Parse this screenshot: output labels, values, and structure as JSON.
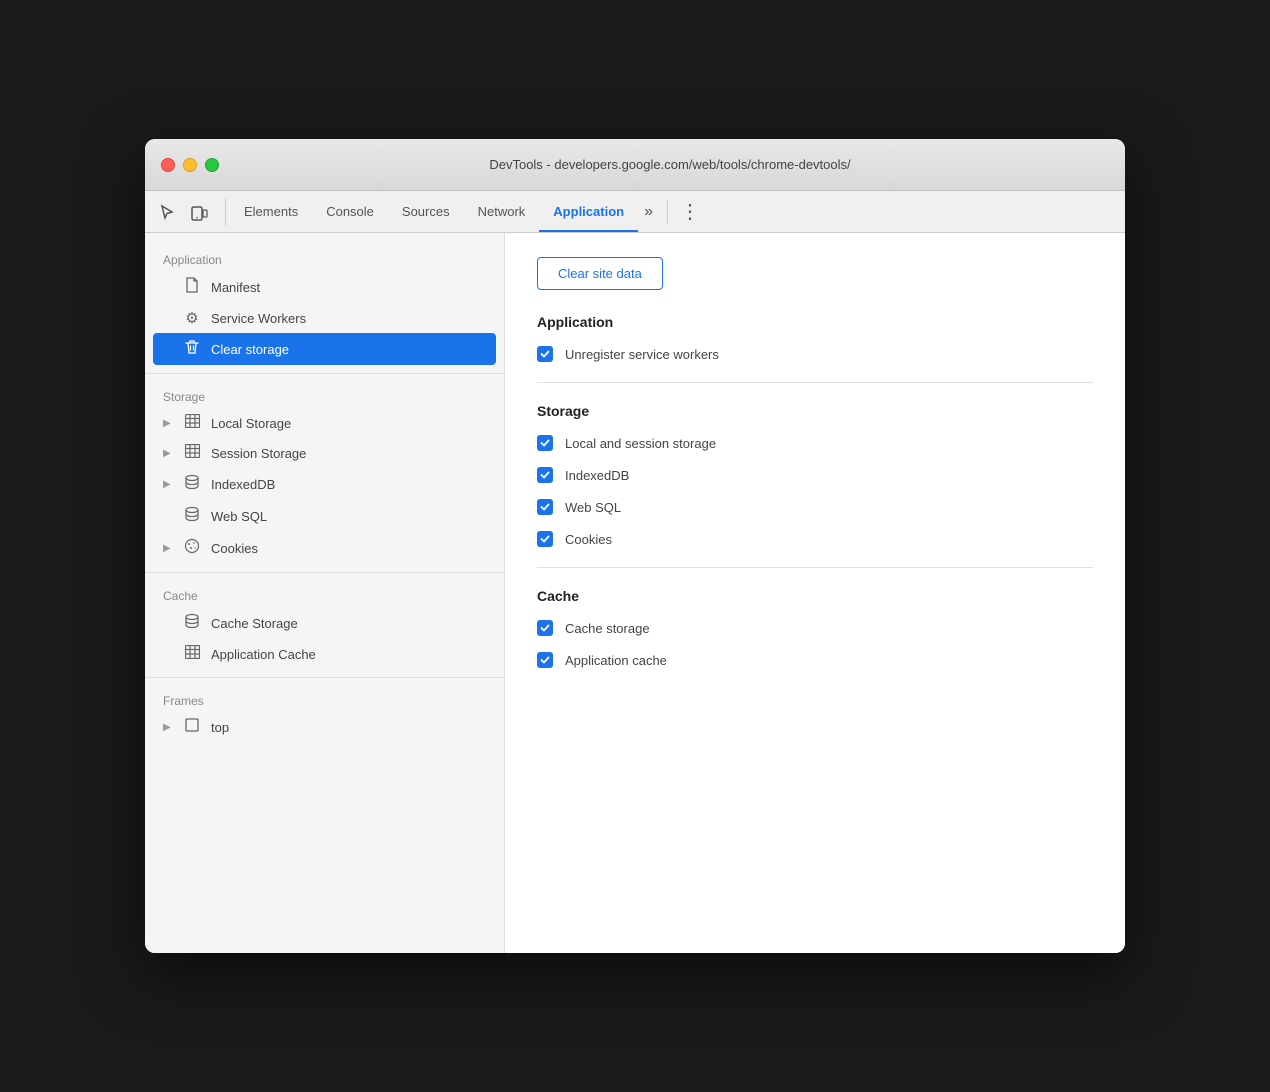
{
  "window": {
    "title": "DevTools - developers.google.com/web/tools/chrome-devtools/",
    "traffic_lights": {
      "close": "close",
      "minimize": "minimize",
      "maximize": "maximize"
    }
  },
  "toolbar": {
    "icons": [
      {
        "name": "cursor-icon",
        "symbol": "⬚"
      },
      {
        "name": "device-icon",
        "symbol": "⧉"
      }
    ],
    "tabs": [
      {
        "id": "elements",
        "label": "Elements",
        "active": false
      },
      {
        "id": "console",
        "label": "Console",
        "active": false
      },
      {
        "id": "sources",
        "label": "Sources",
        "active": false
      },
      {
        "id": "network",
        "label": "Network",
        "active": false
      },
      {
        "id": "application",
        "label": "Application",
        "active": true
      }
    ],
    "more_label": "»",
    "menu_label": "⋮"
  },
  "sidebar": {
    "sections": [
      {
        "id": "application",
        "header": "Application",
        "items": [
          {
            "id": "manifest",
            "label": "Manifest",
            "icon": "📄",
            "arrow": false,
            "active": false
          },
          {
            "id": "service-workers",
            "label": "Service Workers",
            "icon": "⚙",
            "arrow": false,
            "active": false
          },
          {
            "id": "clear-storage",
            "label": "Clear storage",
            "icon": "🗑",
            "arrow": false,
            "active": true
          }
        ]
      },
      {
        "id": "storage",
        "header": "Storage",
        "items": [
          {
            "id": "local-storage",
            "label": "Local Storage",
            "icon": "▦",
            "arrow": true,
            "active": false
          },
          {
            "id": "session-storage",
            "label": "Session Storage",
            "icon": "▦",
            "arrow": true,
            "active": false
          },
          {
            "id": "indexeddb",
            "label": "IndexedDB",
            "icon": "🗄",
            "arrow": true,
            "active": false
          },
          {
            "id": "web-sql",
            "label": "Web SQL",
            "icon": "🗄",
            "arrow": false,
            "active": false
          },
          {
            "id": "cookies",
            "label": "Cookies",
            "icon": "🍪",
            "arrow": true,
            "active": false
          }
        ]
      },
      {
        "id": "cache",
        "header": "Cache",
        "items": [
          {
            "id": "cache-storage",
            "label": "Cache Storage",
            "icon": "🗄",
            "arrow": false,
            "active": false
          },
          {
            "id": "application-cache",
            "label": "Application Cache",
            "icon": "▦",
            "arrow": false,
            "active": false
          }
        ]
      },
      {
        "id": "frames",
        "header": "Frames",
        "items": [
          {
            "id": "top",
            "label": "top",
            "icon": "⬚",
            "arrow": true,
            "active": false
          }
        ]
      }
    ]
  },
  "panel": {
    "clear_button": "Clear site data",
    "sections": [
      {
        "id": "application",
        "title": "Application",
        "checkboxes": [
          {
            "id": "unregister-sw",
            "label": "Unregister service workers",
            "checked": true
          }
        ]
      },
      {
        "id": "storage",
        "title": "Storage",
        "checkboxes": [
          {
            "id": "local-session-storage",
            "label": "Local and session storage",
            "checked": true
          },
          {
            "id": "indexeddb",
            "label": "IndexedDB",
            "checked": true
          },
          {
            "id": "web-sql",
            "label": "Web SQL",
            "checked": true
          },
          {
            "id": "cookies",
            "label": "Cookies",
            "checked": true
          }
        ]
      },
      {
        "id": "cache",
        "title": "Cache",
        "checkboxes": [
          {
            "id": "cache-storage",
            "label": "Cache storage",
            "checked": true
          },
          {
            "id": "application-cache",
            "label": "Application cache",
            "checked": true
          }
        ]
      }
    ]
  }
}
